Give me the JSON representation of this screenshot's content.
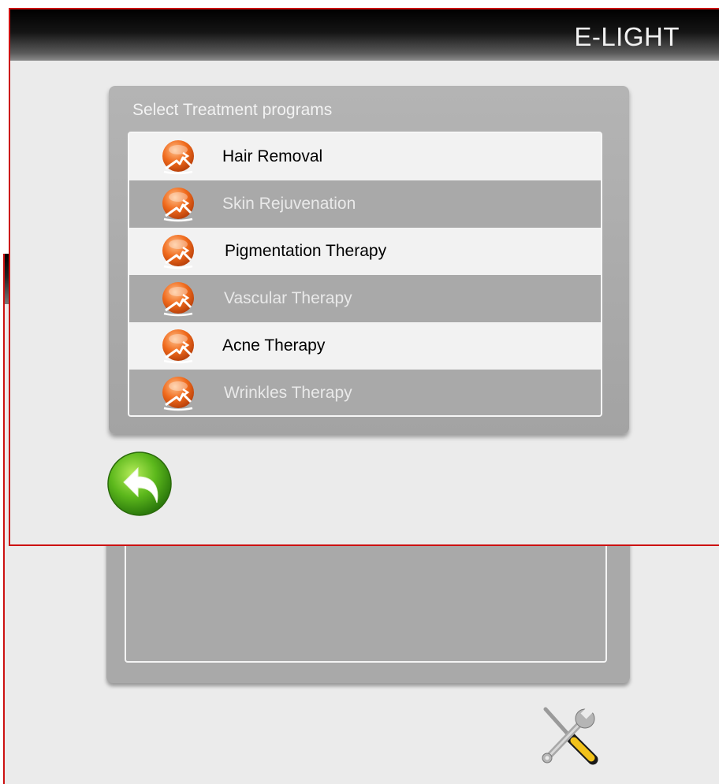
{
  "window": {
    "title": "E-LIGHT"
  },
  "panel": {
    "title": "Select Treatment programs"
  },
  "treatments": [
    {
      "label": "Hair Removal",
      "icon": "treatment-icon"
    },
    {
      "label": "Skin Rejuvenation",
      "icon": "treatment-icon"
    },
    {
      "label": "Pigmentation Therapy",
      "icon": "treatment-icon"
    },
    {
      "label": "Vascular Therapy",
      "icon": "treatment-icon"
    },
    {
      "label": "Acne Therapy",
      "icon": "treatment-icon"
    },
    {
      "label": "Wrinkles  Therapy",
      "icon": "treatment-icon"
    }
  ],
  "icons": {
    "back": "back-arrow-icon",
    "settings": "tools-icon"
  },
  "colors": {
    "accent_orange": "#f06a1c",
    "back_green": "#5cb81c",
    "window_border": "#cc1111",
    "panel_gray": "#a9a9a9"
  }
}
